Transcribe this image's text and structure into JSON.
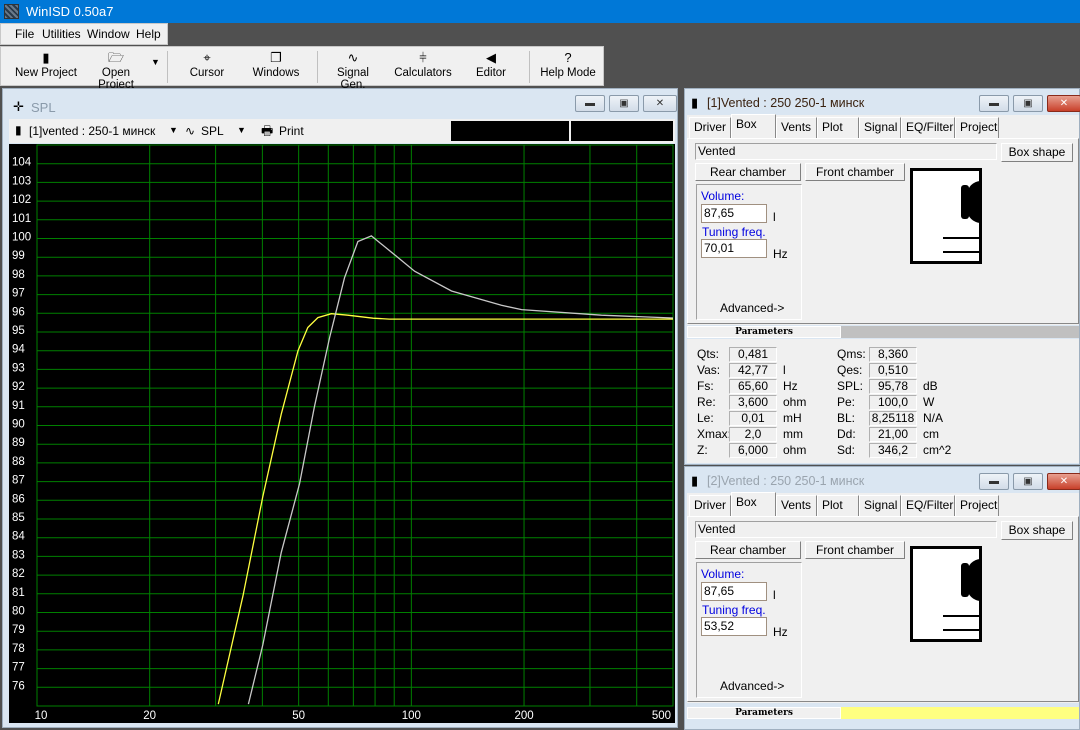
{
  "app": {
    "title": "WinISD 0.50a7"
  },
  "menu": [
    "File",
    "Utilities",
    "Window",
    "Help"
  ],
  "toolbar": [
    {
      "label": "New Project",
      "icon": "new-project-icon"
    },
    {
      "label": "Open Project",
      "icon": "open-folder-icon"
    },
    {
      "label": "Cursor",
      "icon": "crosshair-icon"
    },
    {
      "label": "Windows",
      "icon": "windows-icon"
    },
    {
      "label": "Signal Gen.",
      "icon": "sine-wave-icon"
    },
    {
      "label": "Calculators",
      "icon": "calculator-icon"
    },
    {
      "label": "Editor",
      "icon": "speaker-icon"
    },
    {
      "label": "Help Mode",
      "icon": "question-icon"
    }
  ],
  "spl_window": {
    "title": "SPL",
    "project_select": "[1]vented : 250-1 минск",
    "graph_select": "SPL",
    "print_label": "Print"
  },
  "chart_data": {
    "type": "line",
    "xscale": "log",
    "xlim": [
      10,
      500
    ],
    "ylim": [
      75,
      105
    ],
    "grid": true,
    "background": "#000000",
    "grid_color": "#008000",
    "x_tick_labels": [
      "10",
      "20",
      "50",
      "100",
      "200",
      "500"
    ],
    "x_ticks": [
      10,
      20,
      50,
      100,
      200,
      500
    ],
    "y_ticks": [
      76,
      77,
      78,
      79,
      80,
      81,
      82,
      83,
      84,
      85,
      86,
      87,
      88,
      89,
      90,
      91,
      92,
      93,
      94,
      95,
      96,
      97,
      98,
      99,
      100,
      101,
      102,
      103,
      104
    ],
    "series": [
      {
        "color": "#ffff40",
        "x": [
          30.5,
          35.5,
          40.1,
          44.9,
          49.8,
          52.9,
          56.3,
          61.1,
          67.7,
          79,
          87.3,
          120,
          200,
          500
        ],
        "y": [
          75.1,
          80.9,
          86.2,
          90.6,
          94.0,
          95.24,
          95.77,
          95.98,
          95.9,
          95.74,
          95.69,
          95.69,
          95.69,
          95.69
        ]
      },
      {
        "color": "#c8c8c8",
        "x": [
          36.7,
          40.1,
          44.9,
          50.3,
          55.1,
          60.5,
          66.3,
          72,
          78.2,
          90.2,
          102,
          128,
          174,
          197,
          322,
          500
        ],
        "y": [
          75.1,
          78.27,
          83.2,
          86.9,
          91.0,
          94.7,
          97.9,
          99.84,
          100.14,
          99.13,
          98.25,
          97.19,
          96.43,
          96.2,
          95.9,
          95.75
        ]
      }
    ]
  },
  "project_windows": [
    {
      "title": "[1]Vented : 250 250-1 минск",
      "active": true,
      "tabs": [
        "Driver",
        "Box",
        "Vents",
        "Plot",
        "Signal",
        "EQ/Filter",
        "Project"
      ],
      "active_tab": "Box",
      "box_type": "Vented",
      "box_shape_label": "Box shape",
      "rear_label": "Rear chamber",
      "front_label": "Front chamber",
      "volume_label": "Volume:",
      "volume": "87,65",
      "volume_unit": "l",
      "tuning_label": "Tuning freq.",
      "tuning": "70,01",
      "tuning_unit": "Hz",
      "advanced_label": "Advanced->",
      "parameters_label": "Parameters",
      "params_left": [
        {
          "k": "Qts:",
          "v": "0,481",
          "u": ""
        },
        {
          "k": "Vas:",
          "v": "42,77",
          "u": "l"
        },
        {
          "k": "Fs:",
          "v": "65,60",
          "u": "Hz"
        },
        {
          "k": "Re:",
          "v": "3,600",
          "u": "ohm"
        },
        {
          "k": "Le:",
          "v": "0,01",
          "u": "mH"
        },
        {
          "k": "Xmax:",
          "v": "2,0",
          "u": "mm"
        },
        {
          "k": "Z:",
          "v": "6,000",
          "u": "ohm"
        }
      ],
      "params_right": [
        {
          "k": "Qms:",
          "v": "8,360",
          "u": ""
        },
        {
          "k": "Qes:",
          "v": "0,510",
          "u": ""
        },
        {
          "k": "SPL:",
          "v": "95,78",
          "u": "dB"
        },
        {
          "k": "Pe:",
          "v": "100,0",
          "u": "W"
        },
        {
          "k": "BL:",
          "v": "8,25118",
          "u": "N/A"
        },
        {
          "k": "Dd:",
          "v": "21,00",
          "u": "cm"
        },
        {
          "k": "Sd:",
          "v": "346,2",
          "u": "cm^2"
        }
      ]
    },
    {
      "title": "[2]Vented : 250 250-1 минск",
      "active": false,
      "tabs": [
        "Driver",
        "Box",
        "Vents",
        "Plot",
        "Signal",
        "EQ/Filter",
        "Project"
      ],
      "active_tab": "Box",
      "box_type": "Vented",
      "box_shape_label": "Box shape",
      "rear_label": "Rear chamber",
      "front_label": "Front chamber",
      "volume_label": "Volume:",
      "volume": "87,65",
      "volume_unit": "l",
      "tuning_label": "Tuning freq.",
      "tuning": "53,52",
      "tuning_unit": "Hz",
      "advanced_label": "Advanced->",
      "parameters_label": "Parameters",
      "parameters_bar_color": "#ffff80"
    }
  ]
}
